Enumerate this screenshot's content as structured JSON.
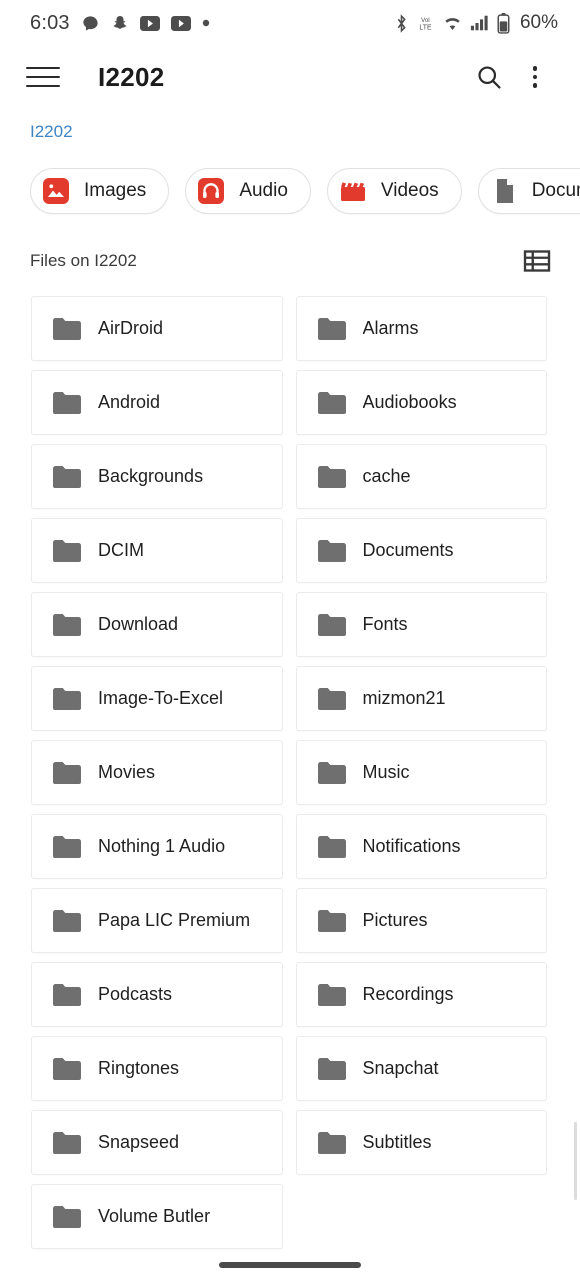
{
  "status_bar": {
    "time": "6:03",
    "battery_percent": "60%",
    "left_icons": [
      "chat-bubble-icon",
      "snapchat-icon",
      "youtube-icon",
      "youtube-icon",
      "dot-icon"
    ],
    "right_icons": [
      "bluetooth-icon",
      "volte-icon",
      "wifi-icon",
      "cellular-signal-icon",
      "battery-icon"
    ]
  },
  "app_bar": {
    "menu_icon": "hamburger-menu-icon",
    "title": "I2202",
    "search_icon": "search-icon",
    "overflow_icon": "more-vertical-icon"
  },
  "breadcrumb": {
    "items": [
      "I2202"
    ],
    "color": "#3d84c6"
  },
  "filter_chips": [
    {
      "label": "Images",
      "icon": "image-icon",
      "color": "#e23b2e"
    },
    {
      "label": "Audio",
      "icon": "headphones-icon",
      "color": "#e23b2e"
    },
    {
      "label": "Videos",
      "icon": "clapperboard-icon",
      "color": "#e23b2e"
    },
    {
      "label": "Documents",
      "icon": "document-icon",
      "color": "#6b6b6b"
    },
    {
      "label": "",
      "icon": "partial-chip",
      "color": "#6b6b6b"
    }
  ],
  "section": {
    "title": "Files on I2202",
    "view_toggle_icon": "list-view-icon"
  },
  "folders": [
    {
      "name": "AirDroid"
    },
    {
      "name": "Alarms"
    },
    {
      "name": "Android"
    },
    {
      "name": "Audiobooks"
    },
    {
      "name": "Backgrounds"
    },
    {
      "name": "cache"
    },
    {
      "name": "DCIM"
    },
    {
      "name": "Documents"
    },
    {
      "name": "Download"
    },
    {
      "name": "Fonts"
    },
    {
      "name": "Image-To-Excel"
    },
    {
      "name": "mizmon21"
    },
    {
      "name": "Movies"
    },
    {
      "name": "Music"
    },
    {
      "name": "Nothing 1 Audio"
    },
    {
      "name": "Notifications"
    },
    {
      "name": "Papa LIC Premium"
    },
    {
      "name": "Pictures"
    },
    {
      "name": "Podcasts"
    },
    {
      "name": "Recordings"
    },
    {
      "name": "Ringtones"
    },
    {
      "name": "Snapchat"
    },
    {
      "name": "Snapseed"
    },
    {
      "name": "Subtitles"
    },
    {
      "name": "Volume Butler"
    }
  ],
  "folder_icon_color": "#6f6f6f",
  "nav_pill": "home-indicator"
}
